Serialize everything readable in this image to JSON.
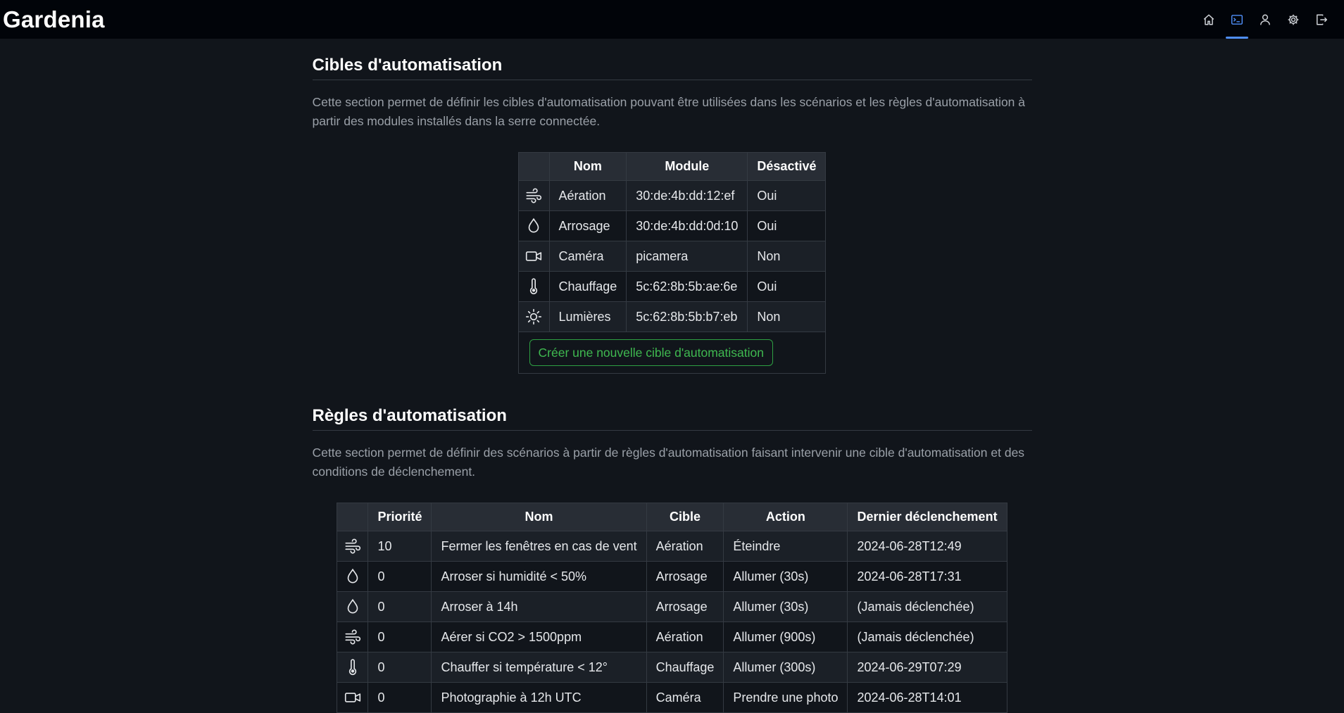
{
  "brand": "Gardenia",
  "nav": {
    "icons": [
      "home-icon",
      "terminal-icon",
      "user-icon",
      "gear-icon",
      "logout-icon"
    ],
    "active": "terminal-icon"
  },
  "colors": {
    "accent": "#4f8ef7",
    "success": "#3fb950",
    "navbar": "#010409",
    "background": "#11151b"
  },
  "targets": {
    "title": "Cibles d'automatisation",
    "description": "Cette section permet de définir les cibles d'automatisation pouvant être utilisées dans les scénarios et les règles d'automatisation à partir des modules installés dans la serre connectée.",
    "headers": {
      "name": "Nom",
      "module": "Module",
      "disabled": "Désactivé"
    },
    "rows": [
      {
        "icon": "wind-icon",
        "name": "Aération",
        "module": "30:de:4b:dd:12:ef",
        "disabled": "Oui"
      },
      {
        "icon": "droplet-icon",
        "name": "Arrosage",
        "module": "30:de:4b:dd:0d:10",
        "disabled": "Oui"
      },
      {
        "icon": "camera-icon",
        "name": "Caméra",
        "module": "picamera",
        "disabled": "Non"
      },
      {
        "icon": "thermometer-icon",
        "name": "Chauffage",
        "module": "5c:62:8b:5b:ae:6e",
        "disabled": "Oui"
      },
      {
        "icon": "sun-icon",
        "name": "Lumières",
        "module": "5c:62:8b:5b:b7:eb",
        "disabled": "Non"
      }
    ],
    "create_label": "Créer une nouvelle cible d'automatisation"
  },
  "rules": {
    "title": "Règles d'automatisation",
    "description": "Cette section permet de définir des scénarios à partir de règles d'automatisation faisant intervenir une cible d'automatisation et des conditions de déclenchement.",
    "headers": {
      "priority": "Priorité",
      "name": "Nom",
      "target": "Cible",
      "action": "Action",
      "last": "Dernier déclenchement"
    },
    "rows": [
      {
        "icon": "wind-icon",
        "priority": "10",
        "name": "Fermer les fenêtres en cas de vent",
        "target": "Aération",
        "action": "Éteindre",
        "last": "2024-06-28T12:49"
      },
      {
        "icon": "droplet-icon",
        "priority": "0",
        "name": "Arroser si humidité < 50%",
        "target": "Arrosage",
        "action": "Allumer (30s)",
        "last": "2024-06-28T17:31"
      },
      {
        "icon": "droplet-icon",
        "priority": "0",
        "name": "Arroser à 14h",
        "target": "Arrosage",
        "action": "Allumer (30s)",
        "last": "(Jamais déclenchée)"
      },
      {
        "icon": "wind-icon",
        "priority": "0",
        "name": "Aérer si CO2 > 1500ppm",
        "target": "Aération",
        "action": "Allumer (900s)",
        "last": "(Jamais déclenchée)"
      },
      {
        "icon": "thermometer-icon",
        "priority": "0",
        "name": "Chauffer si température < 12°",
        "target": "Chauffage",
        "action": "Allumer (300s)",
        "last": "2024-06-29T07:29"
      },
      {
        "icon": "camera-icon",
        "priority": "0",
        "name": "Photographie à 12h UTC",
        "target": "Caméra",
        "action": "Prendre une photo",
        "last": "2024-06-28T14:01"
      }
    ]
  }
}
